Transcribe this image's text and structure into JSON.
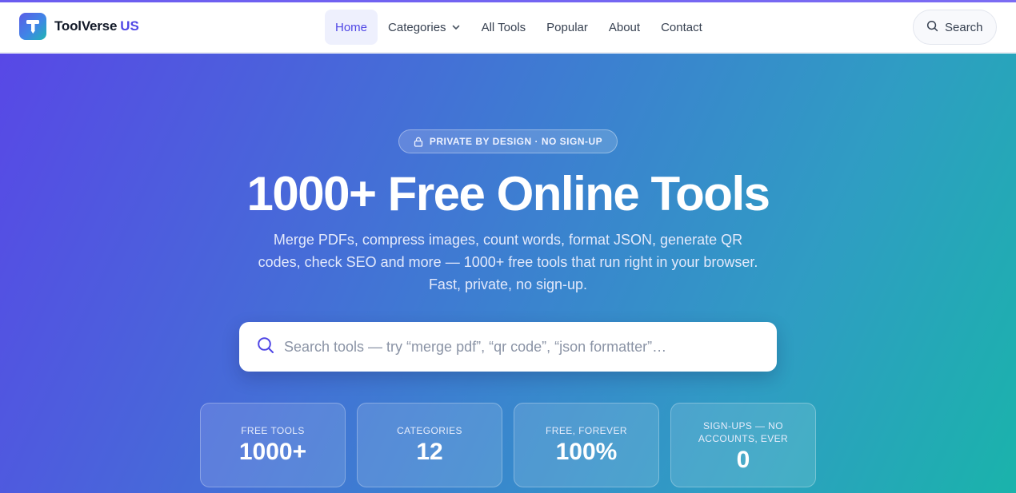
{
  "brand": {
    "name": "ToolVerse",
    "suffix": "US",
    "logo_icon": "t-tool-icon"
  },
  "nav": {
    "items": [
      {
        "label": "Home",
        "active": true
      },
      {
        "label": "Categories",
        "has_dropdown": true
      },
      {
        "label": "All Tools"
      },
      {
        "label": "Popular"
      },
      {
        "label": "About"
      },
      {
        "label": "Contact"
      }
    ],
    "search_label": "Search"
  },
  "hero": {
    "badge": "PRIVATE BY DESIGN · NO SIGN-UP",
    "headline": "1000+ Free Online Tools",
    "subline_1": "Merge PDFs, compress images, count words, format JSON, generate QR",
    "subline_2": "codes, check SEO and more — 1000+ free tools that run right in your browser.",
    "subline_3": "Fast, private, no sign-up.",
    "search_placeholder": "Search tools — try “merge pdf”, “qr code”, “json formatter”…"
  },
  "stats": [
    {
      "label": "FREE TOOLS",
      "value": "1000+"
    },
    {
      "label": "CATEGORIES",
      "value": "12"
    },
    {
      "label": "FREE, FOREVER",
      "value": "100%"
    },
    {
      "label": "SIGN-UPS — NO ACCOUNTS, EVER",
      "value": "0"
    }
  ],
  "colors": {
    "accent": "#4f46e5",
    "hero_gradient_start": "#5848e6",
    "hero_gradient_end": "#1ab3ab"
  }
}
